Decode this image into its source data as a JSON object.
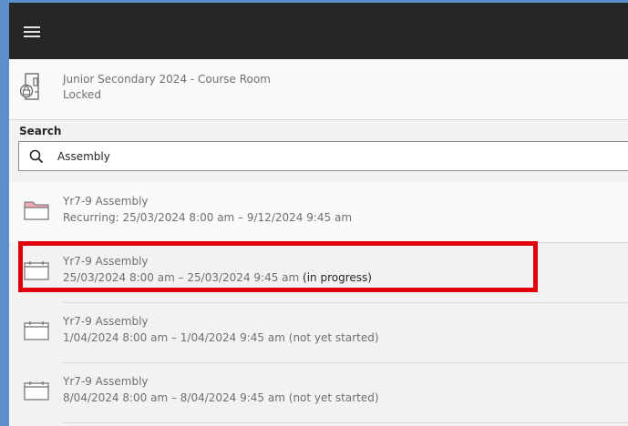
{
  "room": {
    "title": "Junior Secondary 2024 - Course Room",
    "status": "Locked"
  },
  "search": {
    "label": "Search",
    "value": "Assembly"
  },
  "results": [
    {
      "title": "Yr7-9 Assembly",
      "time": "Recurring: 25/03/2024 8:00 am – 9/12/2024 9:45 am",
      "status": "",
      "icon": "folder-icon"
    },
    {
      "title": "Yr7-9 Assembly",
      "time": "25/03/2024 8:00 am – 25/03/2024 9:45 am",
      "status": "(in progress)",
      "icon": "calendar-icon"
    },
    {
      "title": "Yr7-9 Assembly",
      "time": "1/04/2024 8:00 am – 1/04/2024 9:45 am",
      "status": "(not yet started)",
      "icon": "calendar-icon"
    },
    {
      "title": "Yr7-9 Assembly",
      "time": "8/04/2024 8:00 am – 8/04/2024 9:45 am",
      "status": "(not yet started)",
      "icon": "calendar-icon"
    }
  ],
  "colors": {
    "topbar": "#262626",
    "background": "#5b8fc9",
    "highlight": "#e0000b",
    "folder": "#f0a8b4"
  }
}
